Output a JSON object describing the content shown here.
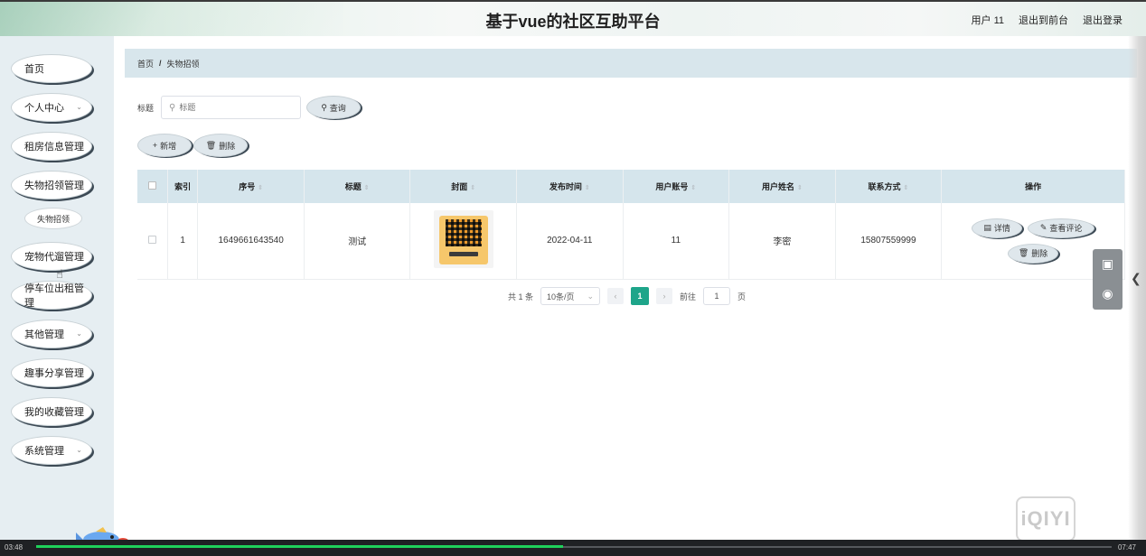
{
  "header": {
    "title": "基于vue的社区互助平台",
    "user": "用户 11",
    "to_front": "退出到前台",
    "logout": "退出登录"
  },
  "sidebar": {
    "items": [
      {
        "label": "首页"
      },
      {
        "label": "个人中心",
        "chevron": true
      },
      {
        "label": "租房信息管理"
      },
      {
        "label": "失物招领管理"
      },
      {
        "label": "宠物代遛管理"
      },
      {
        "label": "停车位出租管理"
      },
      {
        "label": "其他管理",
        "chevron": true
      },
      {
        "label": "趣事分享管理"
      },
      {
        "label": "我的收藏管理"
      },
      {
        "label": "系统管理",
        "chevron": true
      }
    ],
    "sub_item": "失物招领"
  },
  "breadcrumb": {
    "home": "首页",
    "separator": "/",
    "current": "失物招领"
  },
  "search": {
    "label": "标题",
    "placeholder": "标题",
    "button": "查询"
  },
  "actions": {
    "add": "新增",
    "delete": "删除"
  },
  "table": {
    "headers": [
      "索引",
      "序号",
      "标题",
      "封面",
      "发布时间",
      "用户账号",
      "用户姓名",
      "联系方式",
      "操作"
    ],
    "rows": [
      {
        "index": "1",
        "serial": "1649661643540",
        "title": "测试",
        "publish_time": "2022-04-11",
        "account": "11",
        "name": "李密",
        "phone": "15807559999"
      }
    ],
    "ops": {
      "detail": "详情",
      "comment": "查看评论",
      "delete": "删除"
    }
  },
  "pagination": {
    "total": "共 1 条",
    "page_size": "10条/页",
    "current": "1",
    "goto_label": "前往",
    "goto_value": "1",
    "page_unit": "页"
  },
  "video": {
    "elapsed": "03:48",
    "duration": "07:47",
    "progress": 0.49
  },
  "watermark": "iQIYI"
}
